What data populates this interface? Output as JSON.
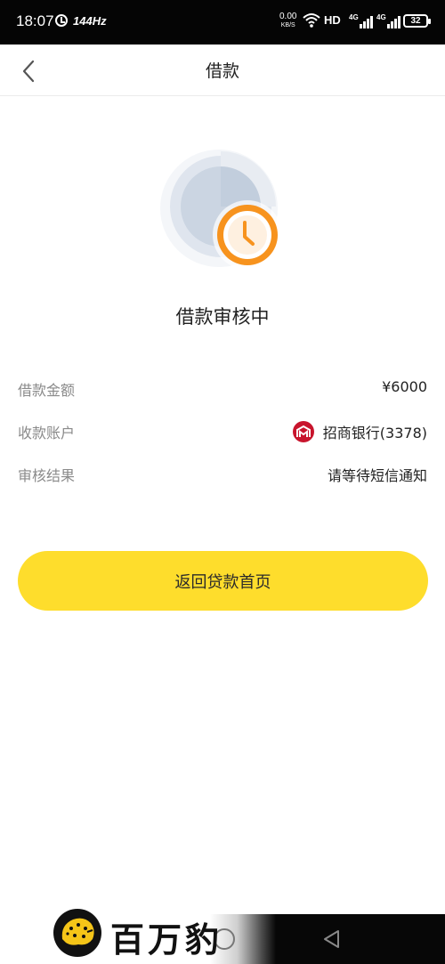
{
  "status_bar": {
    "time": "18:07",
    "refresh_rate": "144Hz",
    "net_speed_value": "0.00",
    "net_speed_unit": "KB/S",
    "hd_label": "HD",
    "network_1": "4G",
    "network_2": "4G",
    "battery": "32"
  },
  "nav": {
    "back_icon": "chevron-left-icon",
    "title": "借款"
  },
  "status": {
    "icon": "clock-pending-icon",
    "accent_color": "#f7931e",
    "title": "借款审核中"
  },
  "details": {
    "amount_label": "借款金额",
    "amount_value": "¥6000",
    "account_label": "收款账户",
    "bank_icon": "china-merchants-bank-logo",
    "bank_name": "招商银行(3378)",
    "result_label": "审核结果",
    "result_value": "请等待短信通知"
  },
  "actions": {
    "primary_label": "返回贷款首页",
    "primary_color": "#fedd2c"
  },
  "watermark": {
    "text": "百万豹"
  }
}
